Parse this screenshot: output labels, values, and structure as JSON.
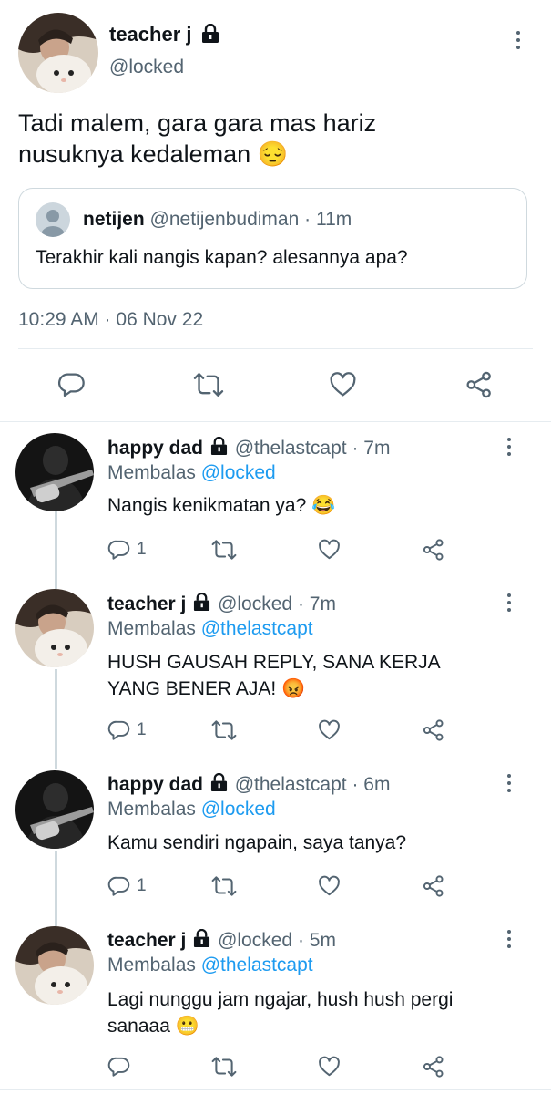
{
  "main_tweet": {
    "display_name": "teacher j",
    "handle": "@locked",
    "text": "Tadi malem, gara gara mas hariz nusuknya kedaleman",
    "emoji": "😔",
    "timestamp": "10:29 AM · 06 Nov 22",
    "quoted": {
      "display_name": "netijen",
      "handle": "@netijenbudiman",
      "time": "· 11m",
      "text": "Terakhir kali nangis kapan? alesannya apa?"
    }
  },
  "replies": [
    {
      "display_name": "happy dad",
      "handle": "@thelastcapt",
      "time": "· 7m",
      "replying_label": "Membalas",
      "replying_to": "@locked",
      "text": "Nangis kenikmatan ya?",
      "emoji": "😂",
      "reply_count": "1"
    },
    {
      "display_name": "teacher j",
      "handle": "@locked",
      "time": "· 7m",
      "replying_label": "Membalas",
      "replying_to": "@thelastcapt",
      "text_line1": "HUSH GAUSAH REPLY, SANA KERJA",
      "text_line2": "YANG BENER AJA!",
      "emoji": "😡",
      "reply_count": "1"
    },
    {
      "display_name": "happy dad",
      "handle": "@thelastcapt",
      "time": "· 6m",
      "replying_label": "Membalas",
      "replying_to": "@locked",
      "text": "Kamu sendiri ngapain, saya tanya?",
      "reply_count": "1"
    },
    {
      "display_name": "teacher j",
      "handle": "@locked",
      "time": "· 5m",
      "replying_label": "Membalas",
      "replying_to": "@thelastcapt",
      "text_line1": "Lagi nunggu jam ngajar, hush hush pergi",
      "text_line2": "sanaaa",
      "emoji": "😬"
    }
  ],
  "icons": {
    "reply": "speech-bubble-icon",
    "retweet": "retweet-icon",
    "like": "heart-icon",
    "share": "share-icon",
    "lock": "lock-icon",
    "more": "more-vertical-icon"
  },
  "colors": {
    "link": "#1d9bf0",
    "secondary_text": "#536471",
    "divider": "#e6ecf0",
    "thread_line": "#cfd9de"
  }
}
